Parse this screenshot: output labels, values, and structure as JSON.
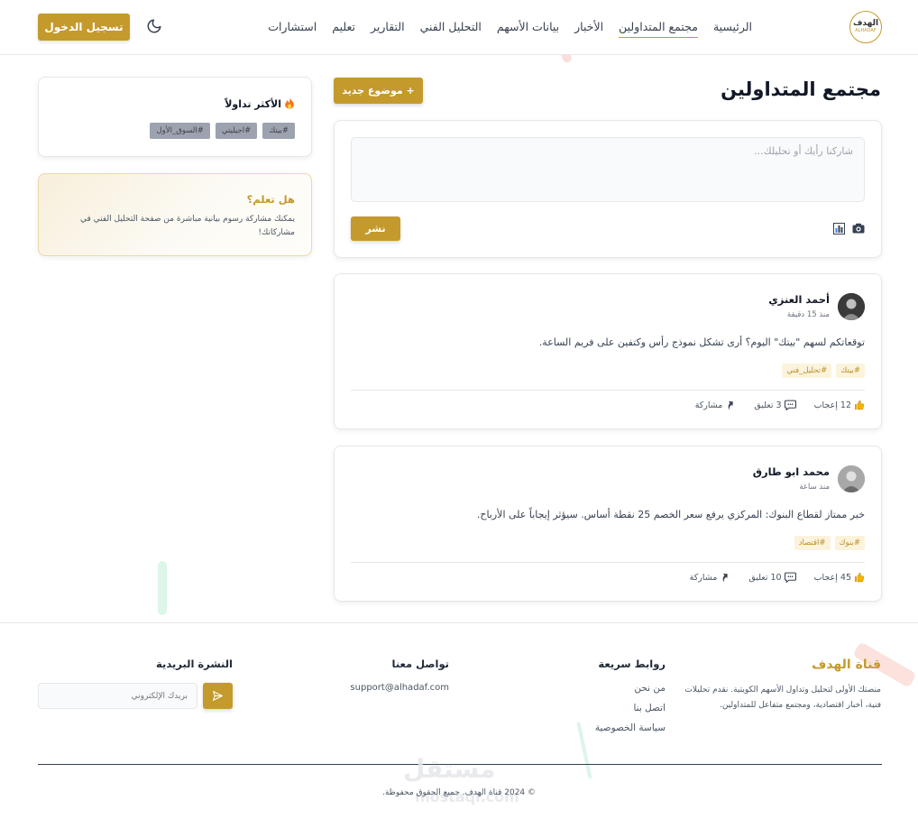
{
  "header": {
    "logo": {
      "line1": "الهدف",
      "line2": "ALHADAF"
    },
    "nav": [
      {
        "label": "الرئيسية",
        "active": false
      },
      {
        "label": "مجتمع المتداولين",
        "active": true
      },
      {
        "label": "الأخبار",
        "active": false
      },
      {
        "label": "بيانات الأسهم",
        "active": false
      },
      {
        "label": "التحليل الفني",
        "active": false
      },
      {
        "label": "التقارير",
        "active": false
      },
      {
        "label": "تعليم",
        "active": false
      },
      {
        "label": "استشارات",
        "active": false
      }
    ],
    "theme_toggle_icon": "moon-icon",
    "login_label": "تسجيل الدخول"
  },
  "main": {
    "title": "مجتمع المتداولين",
    "new_topic_label": "+ موضوع جديد",
    "composer": {
      "placeholder": "شاركنا رأيك أو تحليلك...",
      "publish_label": "نشر",
      "tools": [
        "camera-icon",
        "chart-icon"
      ]
    },
    "posts": [
      {
        "author": "أحمد العنزي",
        "time": "منذ 15 دقيقة",
        "text": "توقعاتكم لسهم \"بيتك\" اليوم؟ أرى تشكل نموذج رأس وكتفين على فريم الساعة.",
        "tags": [
          "#بيتك",
          "#تحليل_فني"
        ],
        "likes": "12 إعجاب",
        "comments": "3 تعليق",
        "share": "مشاركة"
      },
      {
        "author": "محمد ابو طارق",
        "time": "منذ ساعة",
        "text": "خبر ممتاز لقطاع البنوك: المركزي يرفع سعر الخصم 25 نقطة أساس. سيؤثر إيجاباً على الأرباح.",
        "tags": [
          "#بنوك",
          "#اقتصاد"
        ],
        "likes": "45 إعجاب",
        "comments": "10 تعليق",
        "share": "مشاركة"
      }
    ]
  },
  "sidebar": {
    "trending_title": "الأكثر تداولاً",
    "trending_tags": [
      "#بيتك",
      "#اجيليتي",
      "#السوق_الأول"
    ],
    "did_you_know_title": "هل تعلم؟",
    "did_you_know_text": "يمكنك مشاركة رسوم بيانية مباشرة من صفحة التحليل الفني في مشاركاتك!"
  },
  "footer": {
    "brand_title": "قناة الهدف",
    "brand_text": "منصتك الأولى لتحليل وتداول الأسهم الكويتية. نقدم تحليلات فنية، أخبار اقتصادية، ومجتمع متفاعل للمتداولين.",
    "quick_links_title": "روابط سريعة",
    "quick_links": [
      "من نحن",
      "اتصل بنا",
      "سياسة الخصوصية"
    ],
    "contact_title": "تواصل معنا",
    "contact_email": "support@alhadaf.com",
    "newsletter_title": "النشرة البريدية",
    "newsletter_placeholder": "بريدك الإلكتروني",
    "copyright": "© 2024 قناة الهدف. جميع الحقوق محفوظة."
  },
  "watermark": {
    "text": "مستقل",
    "sub": "mostaql.com"
  },
  "colors": {
    "accent": "#c49a2c",
    "tag_bg": "#fbf3dc",
    "trend_tag_bg": "#9ca3af"
  }
}
